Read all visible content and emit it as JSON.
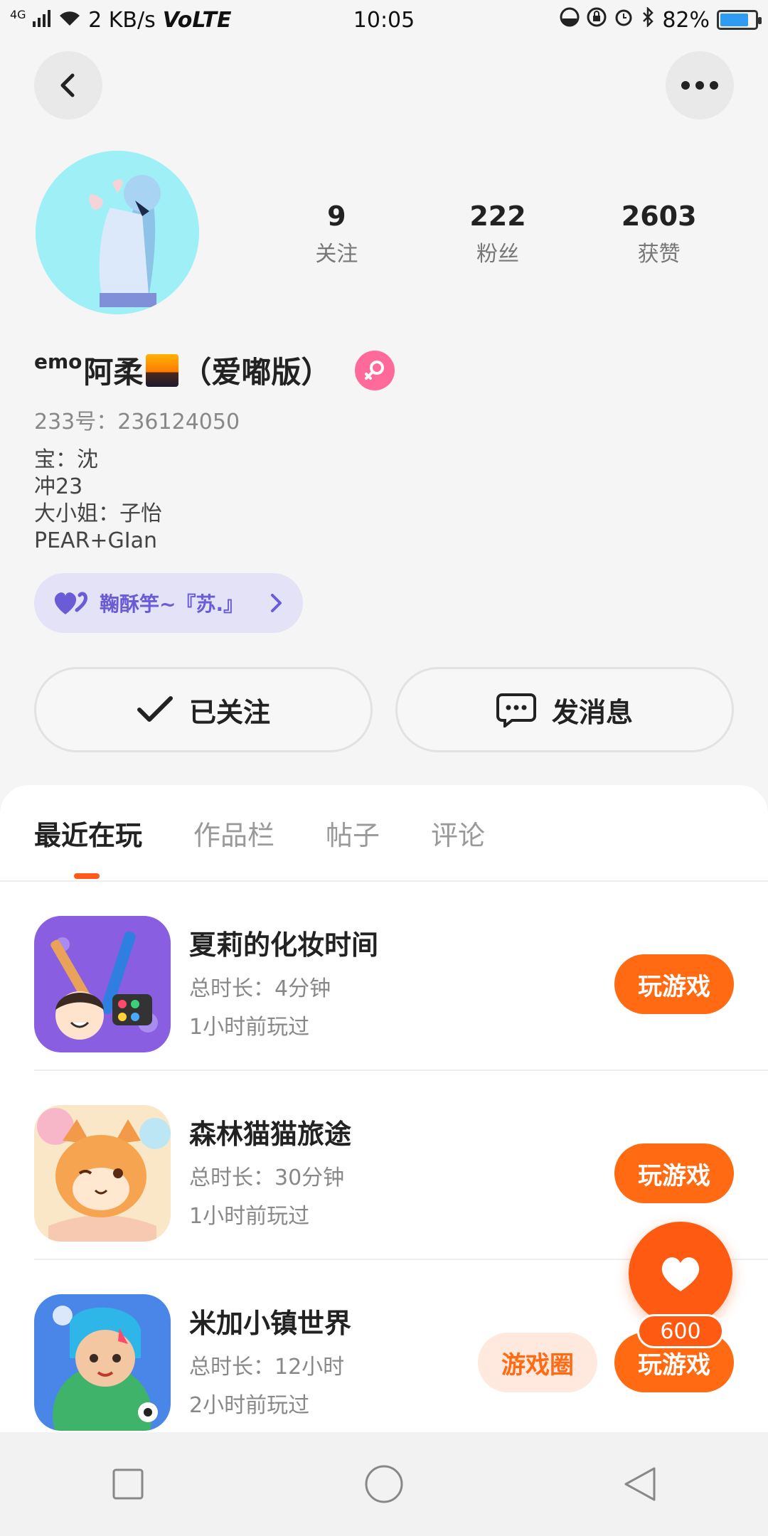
{
  "status_bar": {
    "network": "4G",
    "speed": "2 KB/s",
    "volte": "VoLTE",
    "time": "10:05",
    "battery": "82%",
    "battery_level": 0.82
  },
  "profile": {
    "stats": [
      {
        "value": "9",
        "label": "关注"
      },
      {
        "value": "222",
        "label": "粉丝"
      },
      {
        "value": "2603",
        "label": "获赞"
      }
    ],
    "nickname_prefix": "emo",
    "nickname_main": "阿柔",
    "nickname_suffix": "（爱嘟版）",
    "uid": "233号：236124050",
    "bio": [
      "宝：沈",
      "冲23",
      "大小姐：子怡",
      "PEAR+GIan"
    ],
    "chip_label": "鞠酥竽~『苏.』"
  },
  "actions": {
    "follow_label": "已关注",
    "message_label": "发消息"
  },
  "tabs": [
    "最近在玩",
    "作品栏",
    "帖子",
    "评论"
  ],
  "games": [
    {
      "title": "夏莉的化妆时间",
      "duration": "总时长：4分钟",
      "last_played": "1小时前玩过",
      "play_label": "玩游戏"
    },
    {
      "title": "森林猫猫旅途",
      "duration": "总时长：30分钟",
      "last_played": "1小时前玩过",
      "play_label": "玩游戏"
    },
    {
      "title": "米加小镇世界",
      "duration": "总时长：12小时",
      "last_played": "2小时前玩过",
      "play_label": "玩游戏",
      "circle_label": "游戏圈"
    }
  ],
  "like_fab": {
    "count": "600"
  },
  "colors": {
    "accent": "#ff6a12",
    "chip_bg": "#e3e2f7",
    "chip_text": "#6a5bd6",
    "gender_pink": "#ff6a9a"
  }
}
